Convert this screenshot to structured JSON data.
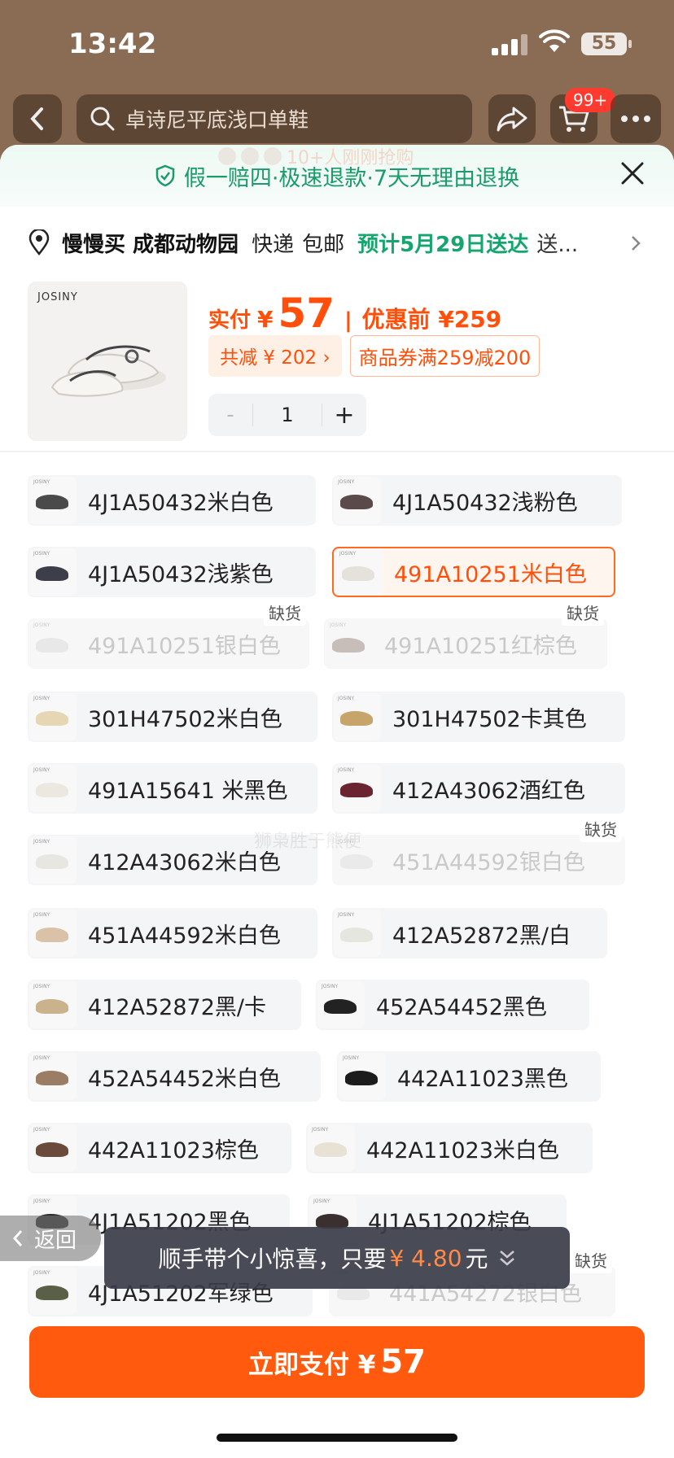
{
  "status": {
    "time": "13:42",
    "battery": "55"
  },
  "nav": {
    "search_placeholder": "卓诗尼平底浅口单鞋",
    "cart_badge": "99+"
  },
  "sheet": {
    "ghost_text": "10+人刚刚抢购",
    "guarantee": "假一赔四·极速退款·7天无理由退换",
    "address": {
      "name": "慢慢买 成都动物园",
      "ship_method": "快递",
      "ship_fee": "包邮",
      "eta": "预计5月29日送达",
      "more": "送..."
    },
    "product": {
      "brand": "JOSINY"
    },
    "price": {
      "label": "实付",
      "currency": "¥",
      "amount": "57",
      "separator": "|",
      "before": "优惠前 ¥259"
    },
    "chips": {
      "discount": "共减 ¥ 202 ›",
      "coupon": "商品券满259减200"
    },
    "stepper": {
      "minus": "-",
      "qty": "1",
      "plus": "+"
    },
    "variants": [
      {
        "label": "4J1A50432米白色",
        "state": "normal",
        "tag": "",
        "color": "#4a4a4a"
      },
      {
        "label": "4J1A50432浅粉色",
        "state": "normal",
        "tag": "",
        "color": "#5a4a4a"
      },
      {
        "label": "4J1A50432浅紫色",
        "state": "normal",
        "tag": "",
        "color": "#3e3e4a"
      },
      {
        "label": "491A10251米白色",
        "state": "selected",
        "tag": "",
        "color": "#e5e2dc"
      },
      {
        "label": "491A10251银白色",
        "state": "disabled",
        "tag": "缺货",
        "color": "#d8d8d8"
      },
      {
        "label": "491A10251红棕色",
        "state": "disabled",
        "tag": "缺货",
        "color": "#8f7a70"
      },
      {
        "label": "301H47502米白色",
        "state": "normal",
        "tag": "",
        "color": "#e6d6b4"
      },
      {
        "label": "301H47502卡其色",
        "state": "normal",
        "tag": "",
        "color": "#c7a56a"
      },
      {
        "label": "491A15641 米黑色",
        "state": "normal",
        "tag": "",
        "color": "#ece8e0"
      },
      {
        "label": "412A43062酒红色",
        "state": "normal",
        "tag": "",
        "color": "#6b2530"
      },
      {
        "label": "412A43062米白色",
        "state": "normal",
        "tag": "",
        "color": "#e8e6e0"
      },
      {
        "label": "451A44592银白色",
        "state": "disabled",
        "tag": "缺货",
        "color": "#dcdcdc"
      },
      {
        "label": "451A44592米白色",
        "state": "normal",
        "tag": "",
        "color": "#d9c2a8"
      },
      {
        "label": "412A52872黑/白",
        "state": "normal",
        "tag": "",
        "color": "#e6e6e0"
      },
      {
        "label": "412A52872黑/卡",
        "state": "normal",
        "tag": "",
        "color": "#c9b28c"
      },
      {
        "label": "452A54452黑色",
        "state": "normal",
        "tag": "",
        "color": "#222222"
      },
      {
        "label": "452A54452米白色",
        "state": "normal",
        "tag": "",
        "color": "#9a7d64"
      },
      {
        "label": "442A11023黑色",
        "state": "normal",
        "tag": "",
        "color": "#1c1c1c"
      },
      {
        "label": "442A11023棕色",
        "state": "normal",
        "tag": "",
        "color": "#6a4a3a"
      },
      {
        "label": "442A11023米白色",
        "state": "normal",
        "tag": "",
        "color": "#e8e2d4"
      },
      {
        "label": "4J1A51202黑色",
        "state": "normal",
        "tag": "",
        "color": "#2a2a2a"
      },
      {
        "label": "4J1A51202棕色",
        "state": "normal",
        "tag": "",
        "color": "#3a3030"
      },
      {
        "label": "4J1A51202军绿色",
        "state": "normal",
        "tag": "",
        "color": "#5a6048"
      },
      {
        "label": "441A54272银白色",
        "state": "disabled",
        "tag": "缺货",
        "color": "#dadada"
      }
    ],
    "watermark": "狮枭胜于熊便",
    "back_pill": "返回",
    "toast": {
      "prefix": "顺手带个小惊喜，只要",
      "amount": "¥ 4.80",
      "suffix": "元"
    },
    "pay_button": {
      "label": "立即支付 ¥",
      "amount": "57"
    }
  },
  "colors": {
    "accent": "#ff5a0d",
    "green": "#17a56f",
    "selected_border": "#ff6a1f"
  }
}
